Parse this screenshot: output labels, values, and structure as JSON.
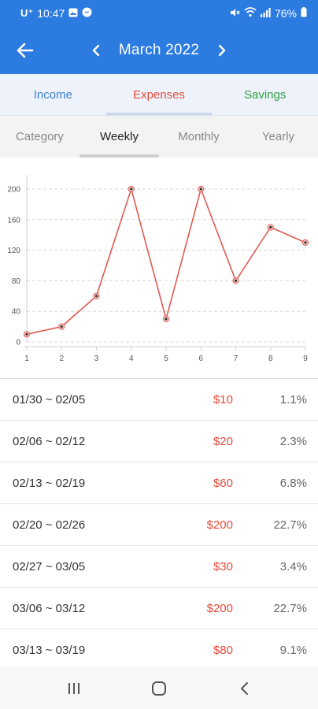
{
  "status": {
    "carrier": "U⁺",
    "time": "10:47",
    "battery": "76%"
  },
  "header": {
    "title": "March 2022"
  },
  "type_tabs": [
    {
      "label": "Income",
      "color": "#3a7fd6"
    },
    {
      "label": "Expenses",
      "color": "#e24c3b"
    },
    {
      "label": "Savings",
      "color": "#2ea043"
    }
  ],
  "period_tabs": [
    {
      "label": "Category"
    },
    {
      "label": "Weekly"
    },
    {
      "label": "Monthly"
    },
    {
      "label": "Yearly"
    }
  ],
  "chart_data": {
    "type": "line",
    "x": [
      1,
      2,
      3,
      4,
      5,
      6,
      7,
      8,
      9
    ],
    "values": [
      10,
      20,
      60,
      200,
      30,
      200,
      80,
      150,
      130
    ],
    "ylim": [
      0,
      200
    ],
    "yticks": [
      0,
      40,
      80,
      120,
      160,
      200
    ],
    "grid": true,
    "line_color": "#e05a52"
  },
  "rows": [
    {
      "range": "01/30 ~ 02/05",
      "amount": "$10",
      "pct": "1.1%"
    },
    {
      "range": "02/06 ~ 02/12",
      "amount": "$20",
      "pct": "2.3%"
    },
    {
      "range": "02/13 ~ 02/19",
      "amount": "$60",
      "pct": "6.8%"
    },
    {
      "range": "02/20 ~ 02/26",
      "amount": "$200",
      "pct": "22.7%"
    },
    {
      "range": "02/27 ~ 03/05",
      "amount": "$30",
      "pct": "3.4%"
    },
    {
      "range": "03/06 ~ 03/12",
      "amount": "$200",
      "pct": "22.7%"
    },
    {
      "range": "03/13 ~ 03/19",
      "amount": "$80",
      "pct": "9.1%"
    }
  ]
}
